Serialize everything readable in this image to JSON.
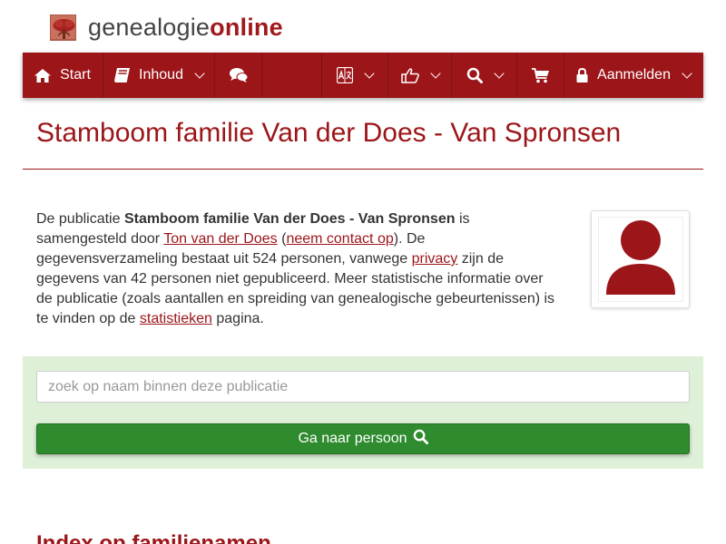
{
  "brand": {
    "part1": "genealogie",
    "part2": "online",
    "logo_icon": "family-tree-logo-icon"
  },
  "nav": {
    "start_label": "Start",
    "inhoud_label": "Inhoud",
    "login_label": "Aanmelden",
    "icons": [
      "home-icon",
      "book-icon",
      "chat-icon",
      "translate-icon",
      "thumbs-up-icon",
      "search-icon",
      "cart-icon",
      "lock-icon"
    ]
  },
  "page": {
    "title": "Stamboom familie Van der Does - Van Spronsen"
  },
  "intro": {
    "t1": "De publicatie ",
    "pub_name": "Stamboom familie Van der Does - Van Spronsen",
    "t2": " is samengesteld door ",
    "author_link": "Ton van der Does",
    "t3": " (",
    "contact_link": "neem contact op",
    "t4": "). De gegevensverzameling bestaat uit 524 personen, vanwege ",
    "privacy_link": "privacy",
    "t5": " zijn de gegevens van 42 personen niet gepubliceerd. Meer statistische informatie over de publicatie (zoals aantallen en spreiding van genealogische gebeurtenissen) is te vinden op de ",
    "stats_link": "statistieken",
    "t6": " pagina."
  },
  "search": {
    "placeholder": "zoek op naam binnen deze publicatie",
    "button_label": "Ga naar persoon"
  },
  "sections": {
    "index_heading": "Index op familienamen"
  },
  "colors": {
    "brand_red": "#9c1519",
    "panel_green": "#dff0d8",
    "button_green": "#2e8b2e"
  }
}
